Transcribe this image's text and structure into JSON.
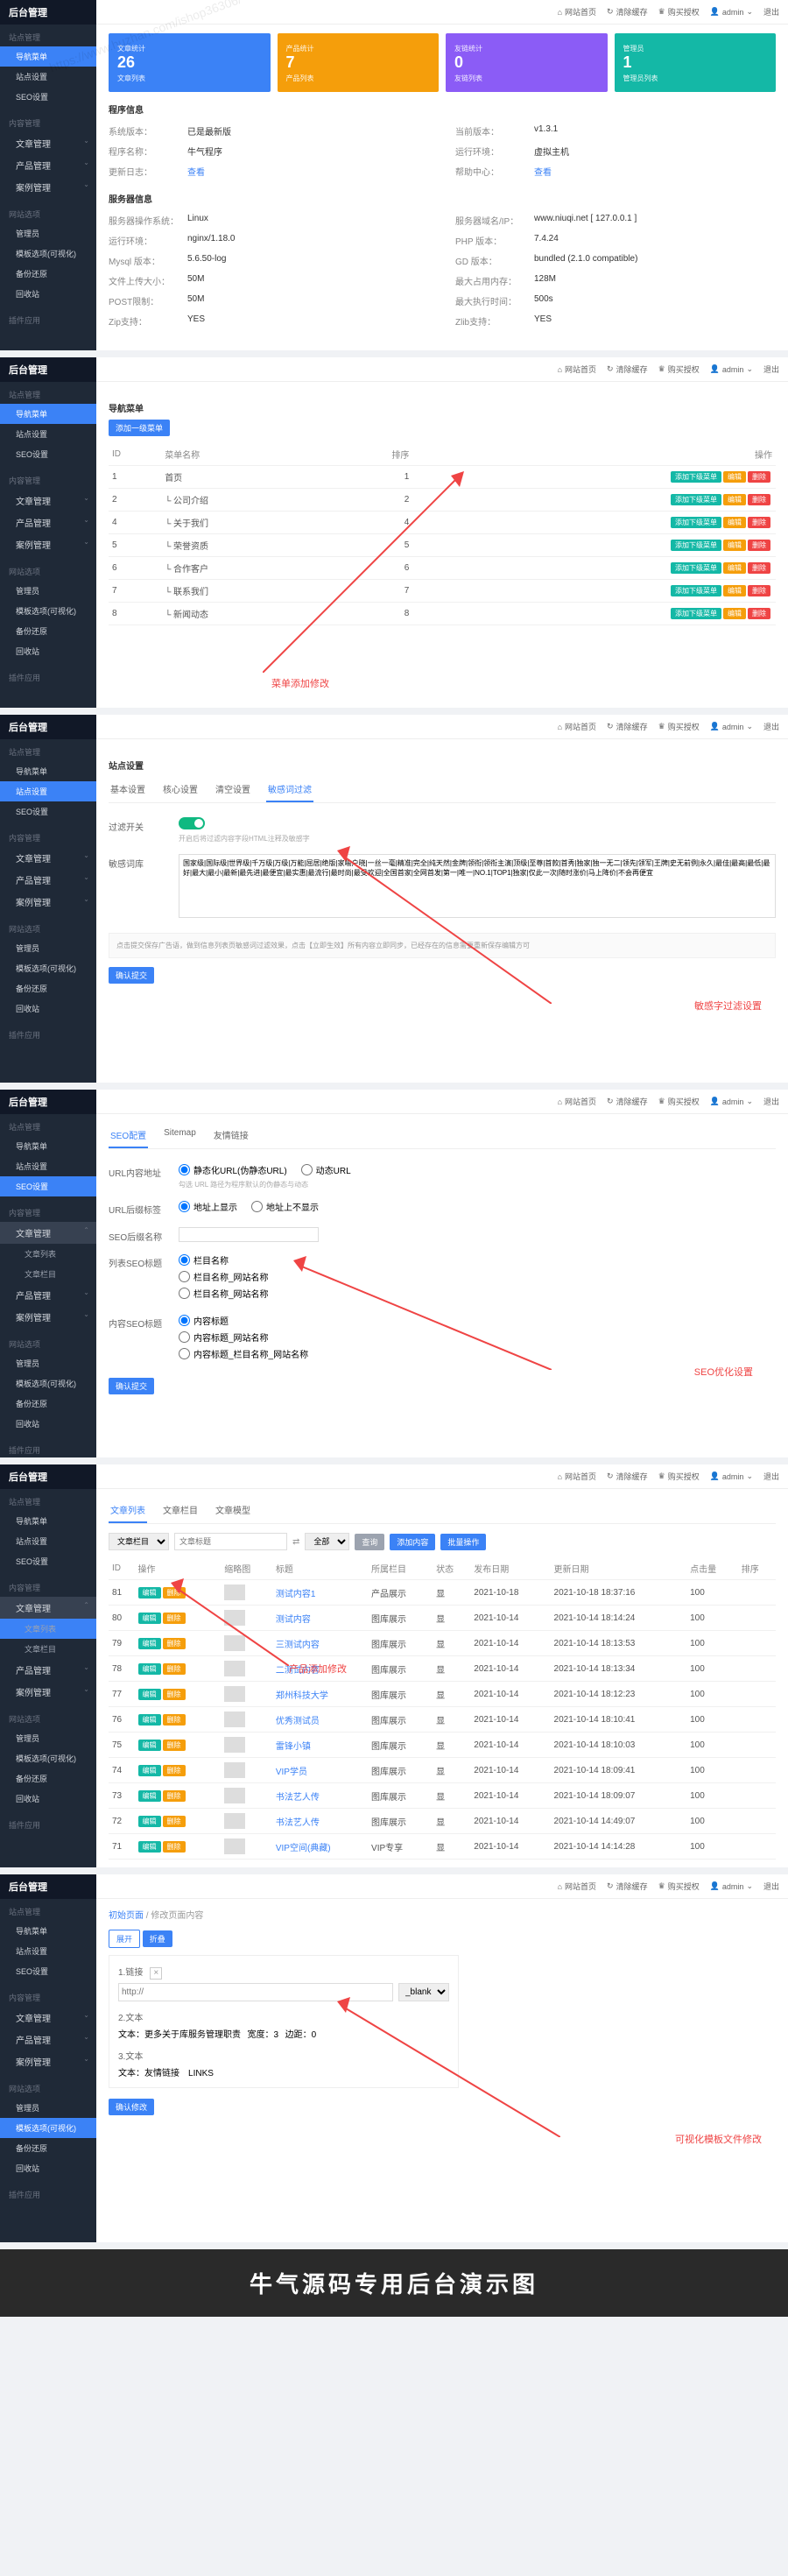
{
  "watermark_url": "https://www.huzhan.com/ishop36306/",
  "topbar": {
    "home": "网站首页",
    "clear_cache": "清除缓存",
    "authorize": "购买授权",
    "user": "admin",
    "logout": "退出"
  },
  "sidebar": {
    "logo": "后台管理",
    "groups": [
      {
        "title": "站点管理",
        "items": [
          {
            "label": "导航菜单"
          },
          {
            "label": "站点设置"
          },
          {
            "label": "SEO设置"
          }
        ]
      },
      {
        "title": "内容管理",
        "items": [
          {
            "label": "文章管理",
            "chev": true
          },
          {
            "label": "产品管理",
            "chev": true
          },
          {
            "label": "案例管理",
            "chev": true
          }
        ]
      },
      {
        "title": "网站选项",
        "items": [
          {
            "label": "管理员"
          },
          {
            "label": "模板选项(可视化)"
          },
          {
            "label": "备份还原"
          },
          {
            "label": "回收站"
          }
        ]
      },
      {
        "title": "插件应用",
        "items": []
      }
    ],
    "article_subs": [
      {
        "label": "文章列表"
      },
      {
        "label": "文章栏目"
      }
    ]
  },
  "panel1": {
    "stats": [
      {
        "num": "26",
        "label": "文章统计",
        "cls": "sc-blue",
        "sub": "文章列表"
      },
      {
        "num": "7",
        "label": "产品统计",
        "cls": "sc-orange",
        "sub": "产品列表"
      },
      {
        "num": "0",
        "label": "友链统计",
        "cls": "sc-purple",
        "sub": "友链列表"
      },
      {
        "num": "1",
        "label": "管理员",
        "cls": "sc-teal",
        "sub": "管理员列表"
      }
    ],
    "prog_title": "程序信息",
    "prog_rows": [
      {
        "l": "系统版本：",
        "v": "已是最新版"
      },
      {
        "l": "程序名称：",
        "v": "牛气程序"
      },
      {
        "l": "更新日志：",
        "v": "查看",
        "link": true
      }
    ],
    "prog_rows2": [
      {
        "l": "当前版本：",
        "v": "v1.3.1"
      },
      {
        "l": "运行环境：",
        "v": "虚拟主机"
      },
      {
        "l": "帮助中心：",
        "v": "查看",
        "link": true
      }
    ],
    "server_title": "服务器信息",
    "server_rows": [
      {
        "l": "服务器操作系统：",
        "v": "Linux"
      },
      {
        "l": "运行环境：",
        "v": "nginx/1.18.0"
      },
      {
        "l": "Mysql 版本：",
        "v": "5.6.50-log"
      },
      {
        "l": "文件上传大小：",
        "v": "50M"
      },
      {
        "l": "POST限制：",
        "v": "50M"
      },
      {
        "l": "Zip支持：",
        "v": "YES"
      }
    ],
    "server_rows2": [
      {
        "l": "服务器域名/IP：",
        "v": "www.niuqi.net [ 127.0.0.1 ]"
      },
      {
        "l": "PHP 版本：",
        "v": "7.4.24"
      },
      {
        "l": "GD 版本：",
        "v": "bundled (2.1.0 compatible)"
      },
      {
        "l": "最大占用内存：",
        "v": "128M"
      },
      {
        "l": "最大执行时间：",
        "v": "500s"
      },
      {
        "l": "Zlib支持：",
        "v": "YES"
      }
    ]
  },
  "panel2": {
    "title": "导航菜单",
    "add_btn": "添加一级菜单",
    "cols": [
      "ID",
      "菜单名称",
      "排序",
      "操作"
    ],
    "rows": [
      {
        "id": "1",
        "name": "首页",
        "sort": "1"
      },
      {
        "id": "2",
        "name": "└ 公司介绍",
        "sort": "2"
      },
      {
        "id": "4",
        "name": "└ 关于我们",
        "sort": "4"
      },
      {
        "id": "5",
        "name": "└ 荣誉资质",
        "sort": "5"
      },
      {
        "id": "6",
        "name": "└ 合作客户",
        "sort": "6"
      },
      {
        "id": "7",
        "name": "└ 联系我们",
        "sort": "7"
      },
      {
        "id": "8",
        "name": "└ 新闻动态",
        "sort": "8"
      }
    ],
    "btn_add_sub": "添加下级菜单",
    "btn_edit": "编辑",
    "btn_del": "删除",
    "annotation": "菜单添加修改"
  },
  "panel3": {
    "title": "站点设置",
    "tabs": [
      "基本设置",
      "核心设置",
      "清空设置",
      "敏感词过滤"
    ],
    "filter_label": "过滤开关",
    "filter_hint": "开启后将过滤内容字段HTML注释及敏感字",
    "words_label": "敏感词库",
    "words_text": "国家级|国际级|世界级|千万级|万级|万能|屈居|绝版|家喻户晓|一丝一毫|精准|完全|纯天然|金牌|领衔|领衔主演|顶级|至尊|首款|首秀|独家|独一无二|领先|领军|王牌|史无前例|永久|最佳|最高|最低|最好|最大|最小|最新|最先进|最便宜|最实惠|最流行|最时尚|最受欢迎|全国首家|全网首发|第一|唯一|NO.1|TOP1|独家|仅此一次|随时涨价|马上降价|不会再便宜",
    "tip": "点击提交保存广告语，做到信息列表页敏感词过滤效果，点击【立即生效】所有内容立即同步，已经存在的信息需要重新保存编辑方可",
    "submit": "确认提交",
    "annotation": "敏感字过滤设置"
  },
  "panel4": {
    "tabs": [
      "SEO配置",
      "Sitemap",
      "友情链接"
    ],
    "url_label": "URL内容地址",
    "url_opts": [
      "静态化URL(伪静态URL)",
      "动态URL"
    ],
    "url_hint": "勾选 URL 路径为程序默认的伪静态与动态",
    "flag_label": "URL后缀标签",
    "flag_opt": "地址上显示",
    "flag_opt2": "地址上不显示",
    "seo_suffix_label": "SEO后缀名称",
    "list_label": "列表SEO标题",
    "list_opts": [
      "栏目名称",
      "栏目名称_网站名称",
      "栏目名称_网站名称"
    ],
    "content_label": "内容SEO标题",
    "content_opts": [
      "内容标题",
      "内容标题_网站名称",
      "内容标题_栏目名称_网站名称"
    ],
    "submit": "确认提交",
    "annotation": "SEO优化设置"
  },
  "panel5": {
    "tabs": [
      "文章列表",
      "文章栏目",
      "文章模型"
    ],
    "toolbar_cat": "文章栏目",
    "toolbar_title": "文章标题",
    "toolbar_all": "全部",
    "btn_search": "查询",
    "btn_add": "添加内容",
    "btn_batch": "批量操作",
    "cols": [
      "ID",
      "操作",
      "缩略图",
      "标题",
      "所属栏目",
      "状态",
      "发布日期",
      "更新日期",
      "点击量",
      "排序"
    ],
    "rows": [
      {
        "id": "81",
        "title": "测试内容1",
        "cat": "产品展示",
        "st": "显",
        "d1": "2021-10-18",
        "d2": "2021-10-18 18:37:16",
        "hits": "100"
      },
      {
        "id": "80",
        "title": "测试内容",
        "cat": "图库展示",
        "st": "显",
        "d1": "2021-10-14",
        "d2": "2021-10-14 18:14:24",
        "hits": "100"
      },
      {
        "id": "79",
        "title": "三测试内容",
        "cat": "图库展示",
        "st": "显",
        "d1": "2021-10-14",
        "d2": "2021-10-14 18:13:53",
        "hits": "100"
      },
      {
        "id": "78",
        "title": "二测试内容",
        "cat": "图库展示",
        "st": "显",
        "d1": "2021-10-14",
        "d2": "2021-10-14 18:13:34",
        "hits": "100"
      },
      {
        "id": "77",
        "title": "郑州科技大学",
        "cat": "图库展示",
        "st": "显",
        "d1": "2021-10-14",
        "d2": "2021-10-14 18:12:23",
        "hits": "100"
      },
      {
        "id": "76",
        "title": "优秀测试员",
        "cat": "图库展示",
        "st": "显",
        "d1": "2021-10-14",
        "d2": "2021-10-14 18:10:41",
        "hits": "100"
      },
      {
        "id": "75",
        "title": "雷锋小镇",
        "cat": "图库展示",
        "st": "显",
        "d1": "2021-10-14",
        "d2": "2021-10-14 18:10:03",
        "hits": "100"
      },
      {
        "id": "74",
        "title": "VIP学员",
        "cat": "图库展示",
        "st": "显",
        "d1": "2021-10-14",
        "d2": "2021-10-14 18:09:41",
        "hits": "100"
      },
      {
        "id": "73",
        "title": "书法艺人传",
        "cat": "图库展示",
        "st": "显",
        "d1": "2021-10-14",
        "d2": "2021-10-14 18:09:07",
        "hits": "100"
      },
      {
        "id": "72",
        "title": "书法艺人传",
        "cat": "图库展示",
        "st": "显",
        "d1": "2021-10-14",
        "d2": "2021-10-14 14:49:07",
        "hits": "100"
      },
      {
        "id": "71",
        "title": "VIP空间(典藏)",
        "cat": "VIP专享",
        "st": "显",
        "d1": "2021-10-14",
        "d2": "2021-10-14 14:14:28",
        "hits": "100"
      }
    ],
    "annotation": "产品添加修改"
  },
  "panel6": {
    "breadcrumb_home": "初始页面",
    "breadcrumb_sep": " / ",
    "breadcrumb_cur": "修改页面内容",
    "btn_expand": "展开",
    "btn_collapse": "折叠",
    "field1": "1.链接",
    "url_placeholder": "http://",
    "target": "_blank",
    "field2": "2.文本",
    "text_label": "文本：",
    "text_val": "更多关于库服务管理职责",
    "text_label2": "宽度：",
    "text_val2": "3",
    "text_label3": "边距：",
    "text_val3": "0",
    "field3": "3.文本",
    "text3_label": "文本：",
    "text3_val": "友情链接",
    "text3_val2": "LINKS",
    "submit": "确认修改",
    "annotation": "可视化模板文件修改"
  },
  "footer": "牛气源码专用后台演示图"
}
